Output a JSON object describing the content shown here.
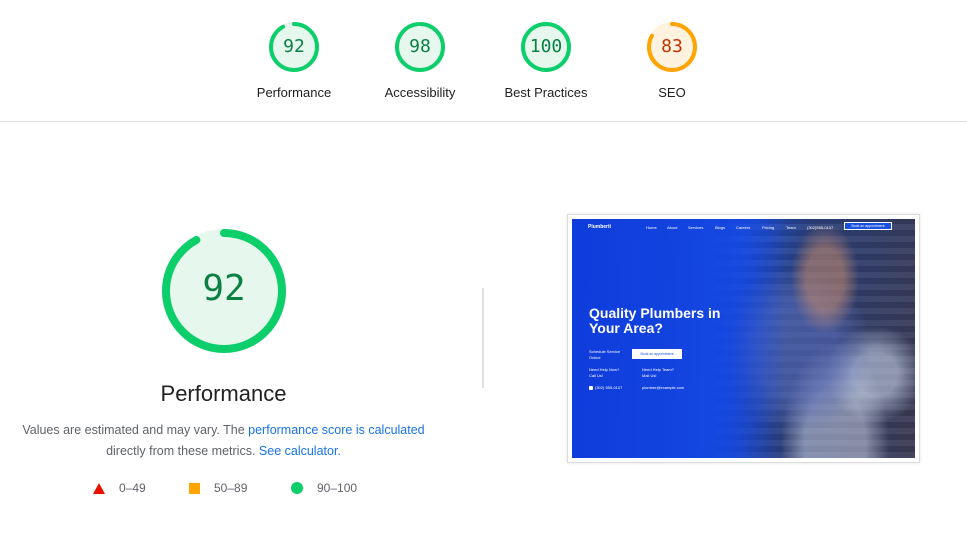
{
  "summary": {
    "gauges": [
      {
        "score": "92",
        "label": "Performance",
        "status": "pass"
      },
      {
        "score": "98",
        "label": "Accessibility",
        "status": "pass"
      },
      {
        "score": "100",
        "label": "Best Practices",
        "status": "pass"
      },
      {
        "score": "83",
        "label": "SEO",
        "status": "average"
      }
    ]
  },
  "performance": {
    "score": "92",
    "title": "Performance",
    "desc_text1": "Values are estimated and may vary. The ",
    "desc_link1": "performance score is calculated",
    "desc_text2": "directly from these metrics. ",
    "desc_link2": "See calculator."
  },
  "legend": [
    {
      "icon": "triangle-fail-icon",
      "range": "0–49",
      "color": "#eb0f00"
    },
    {
      "icon": "square-average-icon",
      "range": "50–89",
      "color": "#ffa400"
    },
    {
      "icon": "circle-pass-icon",
      "range": "90–100",
      "color": "#0cce6b"
    }
  ],
  "colors": {
    "pass_ring": "#0cce6b",
    "pass_fill": "#e6f7ed",
    "pass_text": "#0b8043",
    "average_ring": "#ffa400",
    "average_fill": "#fff3e0",
    "average_text": "#c33300",
    "link": "#1a73e8"
  },
  "screenshot": {
    "brand": "Plumberit",
    "nav_links": [
      "Home",
      "About",
      "Services",
      "Blogs",
      "Careers",
      "Pricing",
      "Team",
      "(302)555-0107"
    ],
    "cta": "Book an appointment",
    "hero_title": "Quality Plumbers in Your Area?",
    "schedule_label": "Schedule Service",
    "schedule_value": "Online",
    "button": "Book an appointment",
    "help_label": "Need Help Now?",
    "help_value": "Call Us!",
    "team_label": "Need Help Team?",
    "team_value": "Mail Us!",
    "phone": "(302) 555-0107",
    "email": "plumber@example.com"
  }
}
